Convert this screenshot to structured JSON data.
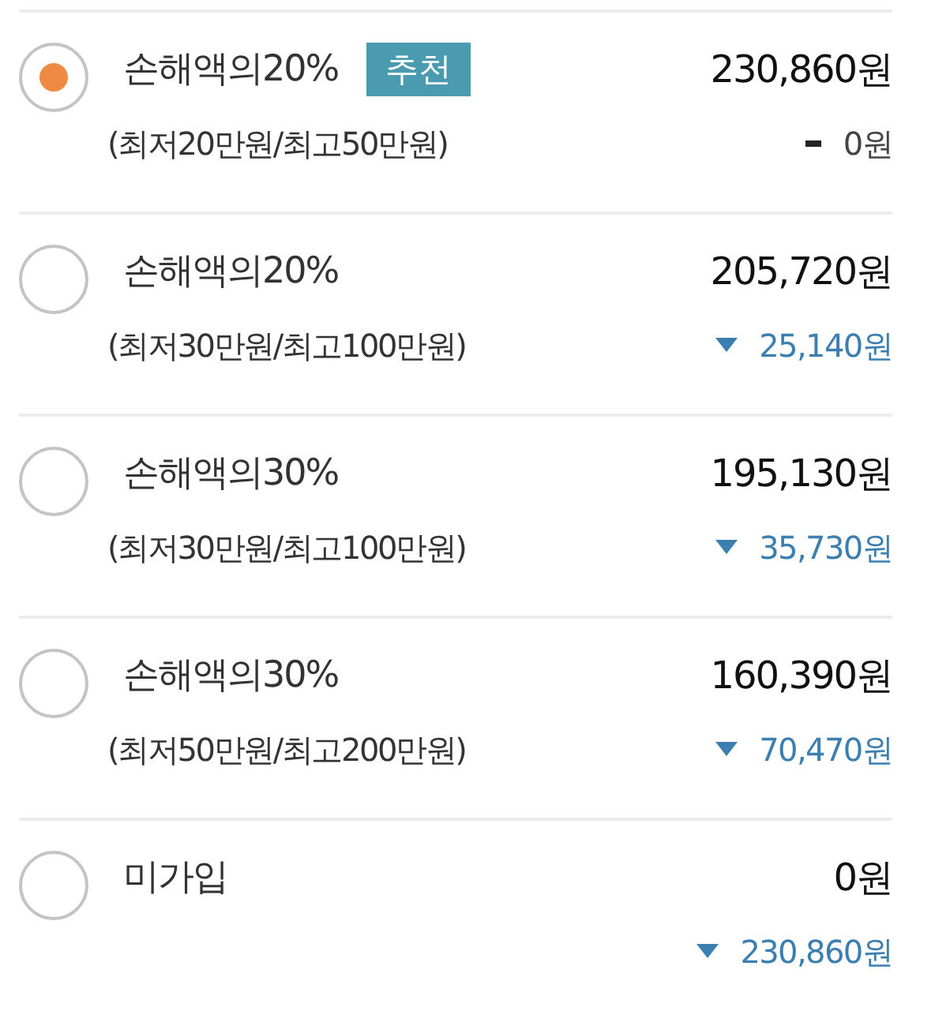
{
  "options": [
    {
      "title": "손해액의20%",
      "badge": "추천",
      "subtitle": "(최저20만원/최고50만원)",
      "price": "230,860원",
      "kind": "unchanged",
      "change": "0원",
      "selected": true
    },
    {
      "title": "손해액의20%",
      "subtitle": "(최저30만원/최고100만원)",
      "price": "205,720원",
      "kind": "decrease",
      "change": "25,140원",
      "selected": false
    },
    {
      "title": "손해액의30%",
      "subtitle": "(최저30만원/최고100만원)",
      "price": "195,130원",
      "kind": "decrease",
      "change": "35,730원",
      "selected": false
    },
    {
      "title": "손해액의30%",
      "subtitle": "(최저50만원/최고200만원)",
      "price": "160,390원",
      "kind": "decrease",
      "change": "70,470원",
      "selected": false
    },
    {
      "title": "미가입",
      "price": "0원",
      "kind": "decrease",
      "change": "230,860원",
      "selected": false
    }
  ]
}
